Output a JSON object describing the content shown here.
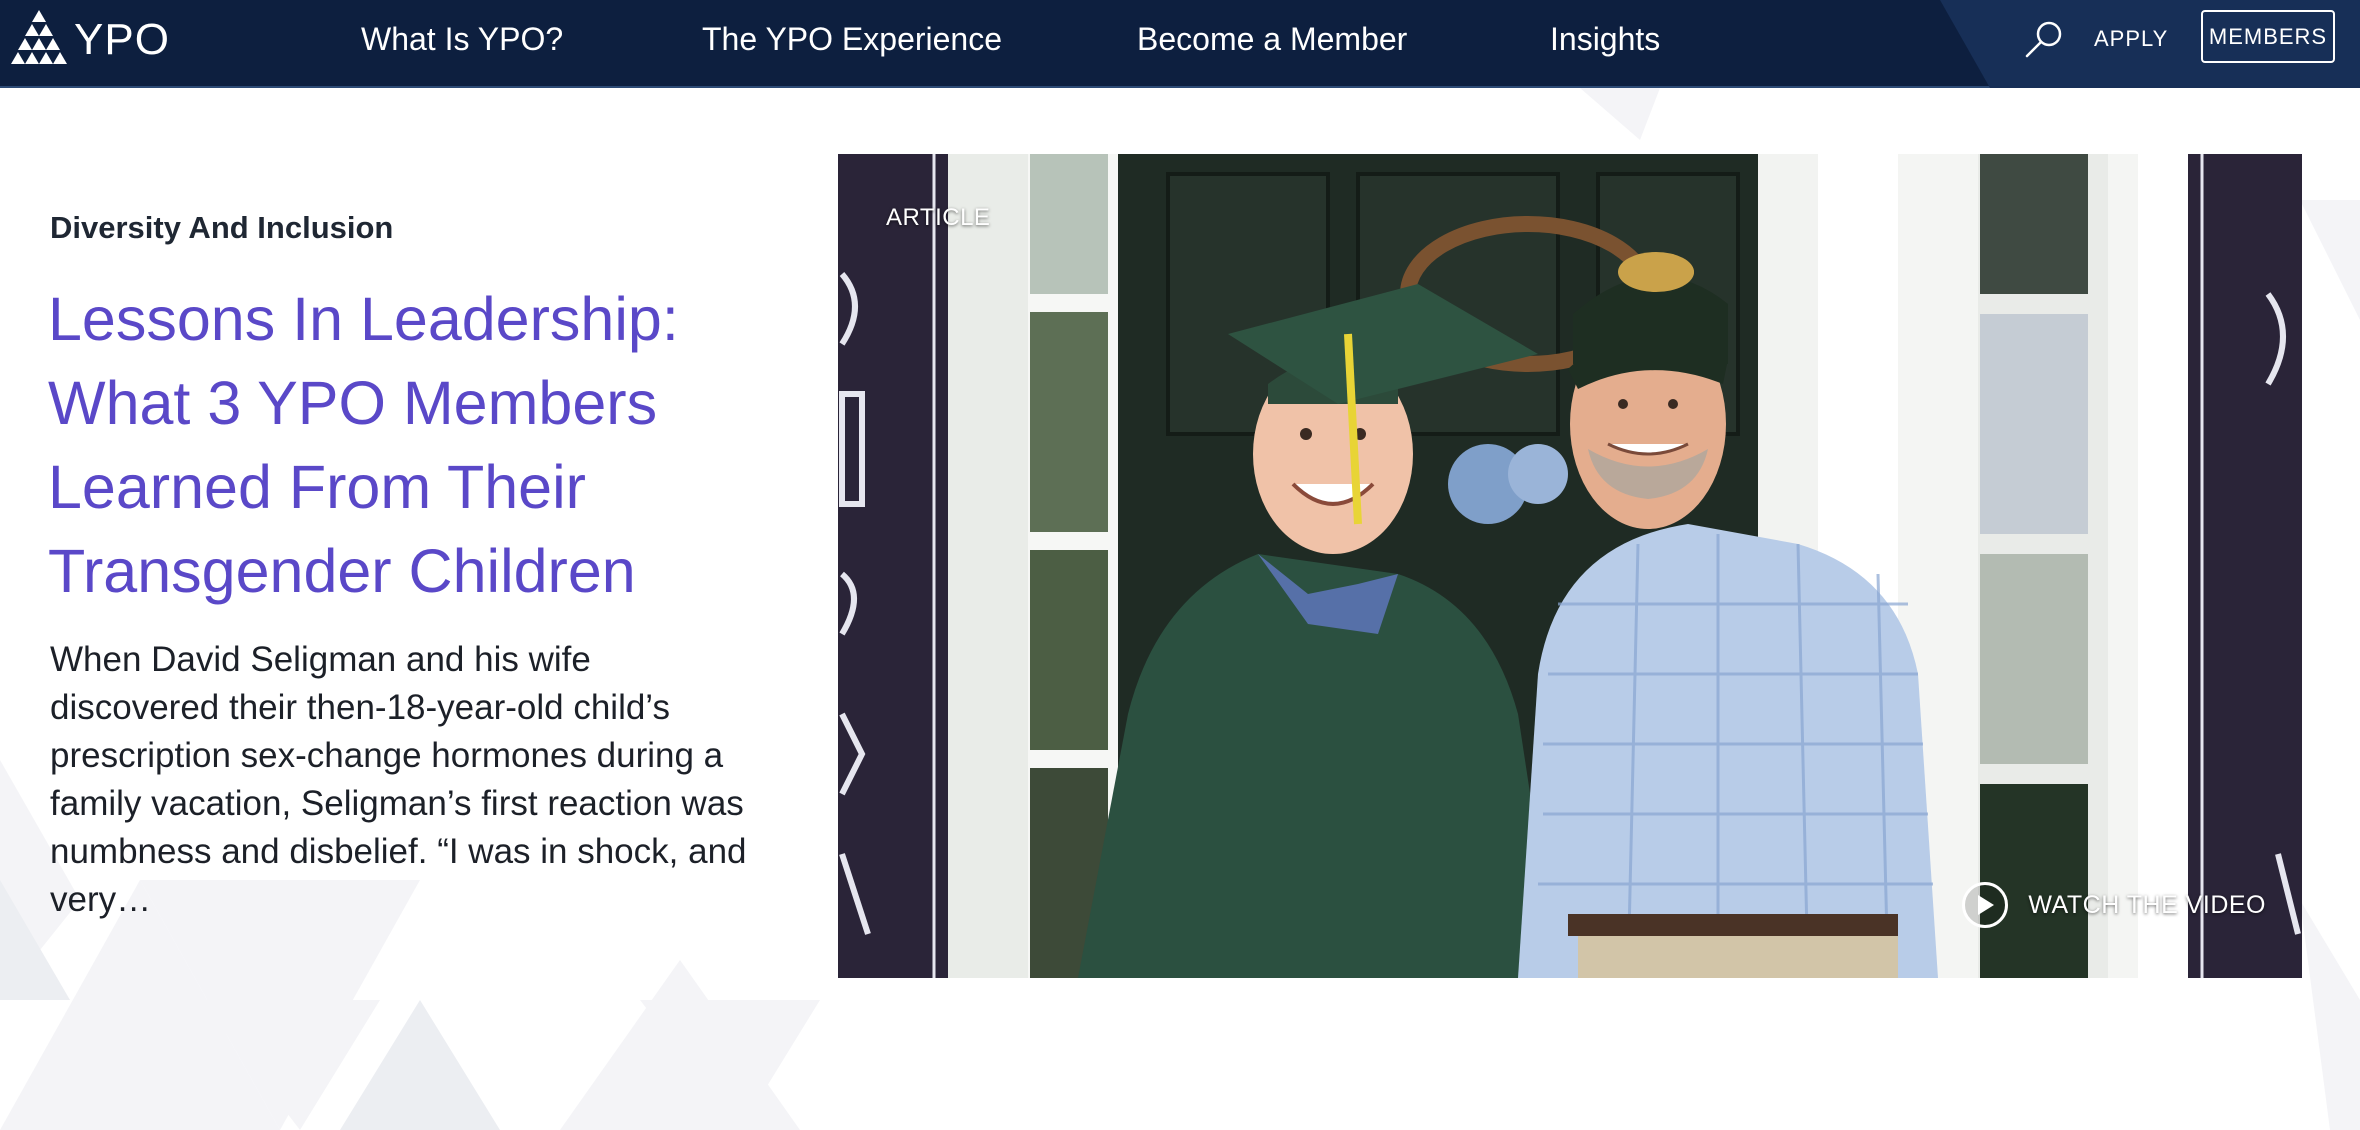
{
  "brand": {
    "name": "YPO",
    "logo_icon": "ypo-triangle-logo-icon"
  },
  "nav": {
    "items": [
      {
        "label": "What Is YPO?"
      },
      {
        "label": "The YPO Experience"
      },
      {
        "label": "Become a Member"
      },
      {
        "label": "Insights"
      }
    ],
    "search_icon": "search-icon",
    "apply_label": "APPLY",
    "members_label": "MEMBERS"
  },
  "article": {
    "category": "Diversity And Inclusion",
    "title": "Lessons In Leadership: What 3 YPO Members Learned From Their Transgender Children",
    "excerpt": "When David Seligman and his wife discovered their then-18-year-old child’s prescription sex-change hormones during a family vacation, Seligman’s first reaction was numbness and disbelief. “I was in shock, and very…",
    "media_type": "ARTICLE",
    "watch_label": "WATCH THE VIDEO",
    "play_icon": "play-icon"
  },
  "colors": {
    "nav_bg": "#0d1f3f",
    "nav_accent": "#172f57",
    "headline": "#5a48c8",
    "body_text": "#1c2028"
  }
}
